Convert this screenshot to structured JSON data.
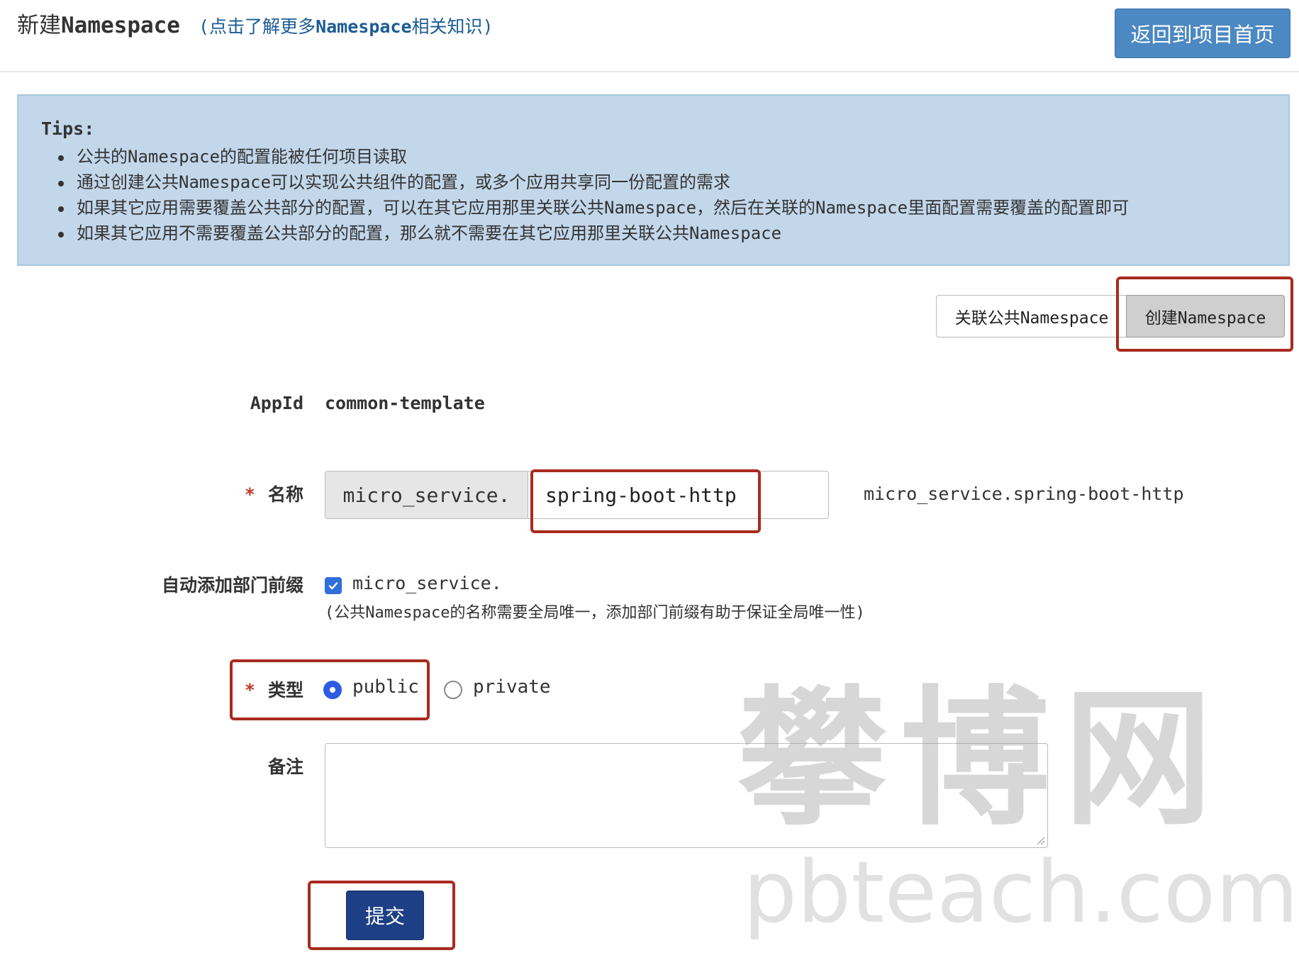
{
  "header": {
    "title_prefix": "新建",
    "title_name": "Namespace",
    "learn_open": "(点击了解更多",
    "learn_name": "Namespace",
    "learn_close": "相关知识)",
    "back_button": "返回到项目首页"
  },
  "tips": {
    "title": "Tips:",
    "items": [
      "公共的Namespace的配置能被任何项目读取",
      "通过创建公共Namespace可以实现公共组件的配置，或多个应用共享同一份配置的需求",
      "如果其它应用需要覆盖公共部分的配置，可以在其它应用那里关联公共Namespace，然后在关联的Namespace里面配置需要覆盖的配置即可",
      "如果其它应用不需要覆盖公共部分的配置，那么就不需要在其它应用那里关联公共Namespace"
    ]
  },
  "actions": {
    "link_public": "关联公共Namespace",
    "create": "创建Namespace"
  },
  "form": {
    "appid_label": "AppId",
    "appid_value": "common-template",
    "required_mark": "*",
    "name_label": "名称",
    "name_prefix": "micro_service.",
    "name_value": "spring-boot-http",
    "name_preview": "micro_service.spring-boot-http",
    "auto_prefix_label": "自动添加部门前缀",
    "auto_prefix_checked": true,
    "auto_prefix_value": "micro_service.",
    "auto_prefix_help": "(公共Namespace的名称需要全局唯一，添加部门前缀有助于保证全局唯一性)",
    "type_label": "类型",
    "type_options": [
      "public",
      "private"
    ],
    "type_selected": "public",
    "remark_label": "备注",
    "remark_value": "",
    "submit": "提交"
  },
  "colors": {
    "primary_button": "#4c88c2",
    "submit_button": "#1d3f85",
    "tips_background": "#c3d7ea",
    "annotation_red": "#a82a1e",
    "radio_selected": "#2d5be3"
  },
  "watermark": {
    "cn": "攀博网",
    "en": "pbteach.com"
  }
}
